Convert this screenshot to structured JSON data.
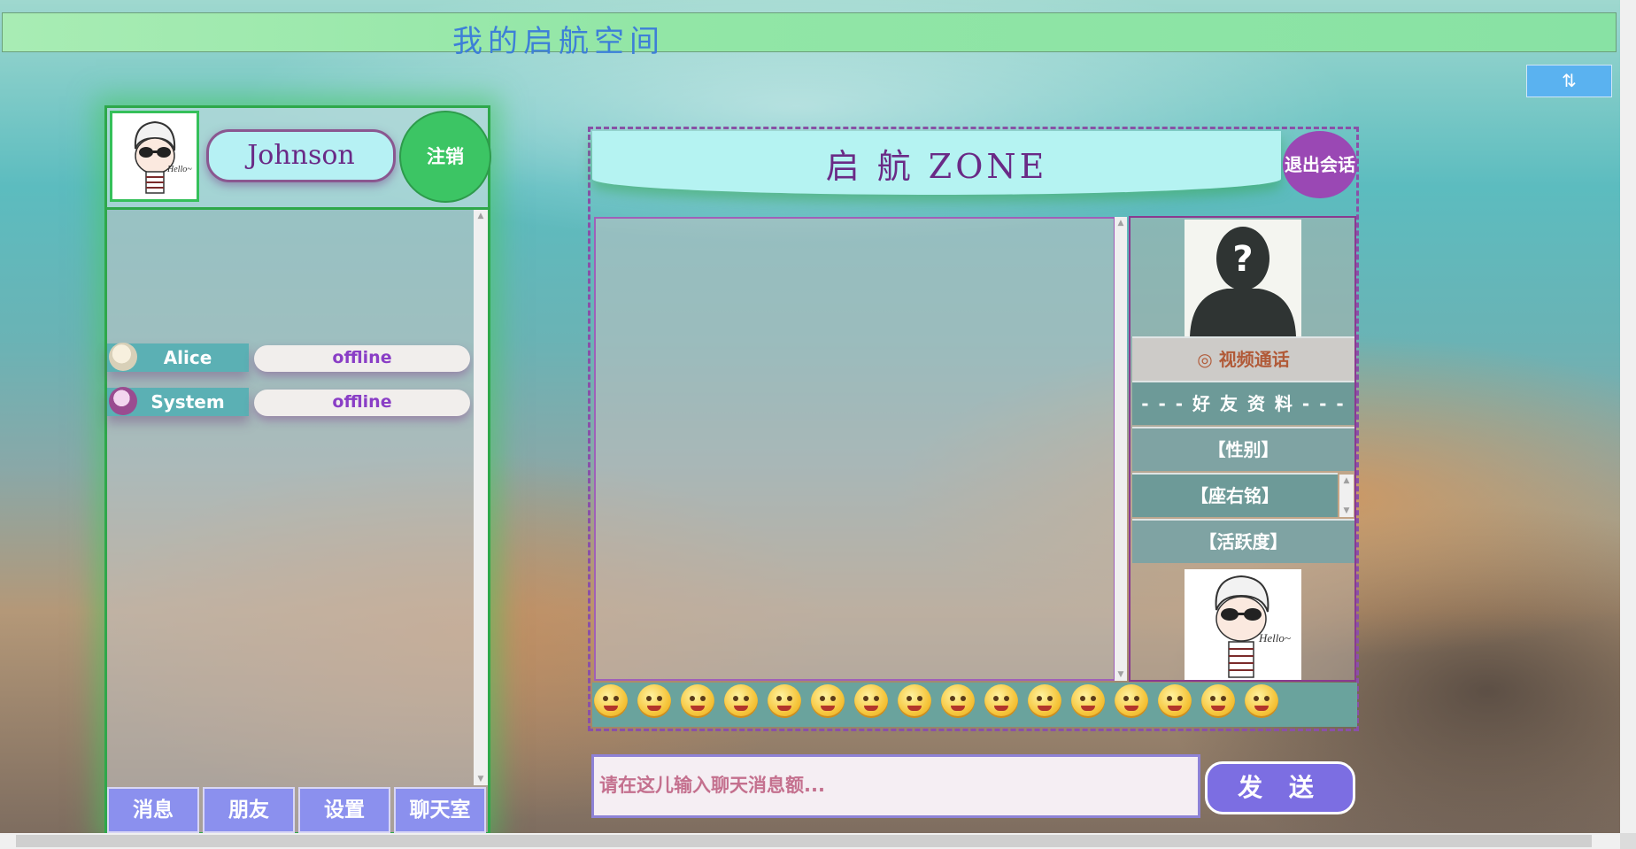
{
  "banner": {
    "title": "我的启航空间"
  },
  "sort_button": {
    "label": "⇅"
  },
  "profile": {
    "username": "Johnson",
    "logout_label": "注销"
  },
  "friends": [
    {
      "name": "Alice",
      "status": "offline"
    },
    {
      "name": "System",
      "status": "offline"
    }
  ],
  "bottom_nav": [
    {
      "label": "消息"
    },
    {
      "label": "朋友"
    },
    {
      "label": "设置"
    },
    {
      "label": "聊天室"
    }
  ],
  "chat": {
    "title": "启 航 ZONE",
    "exit_label": "退出会话",
    "avatar_label": "?",
    "info_rows": [
      {
        "label": "◎ 视频通话"
      },
      {
        "label": "- - - 好 友 资 料 - - -"
      },
      {
        "label": "【性别】"
      },
      {
        "label": "【座右铭】"
      },
      {
        "label": "【活跃度】"
      }
    ],
    "emoji_count": 16,
    "input_placeholder": "请在这儿输入聊天消息额...",
    "send_label": "发 送"
  },
  "colors": {
    "accent_green": "#2ea84a",
    "nav_purple": "#8b90ee",
    "title_purple": "#6a2a86",
    "status_purple": "#8a3ec6"
  }
}
